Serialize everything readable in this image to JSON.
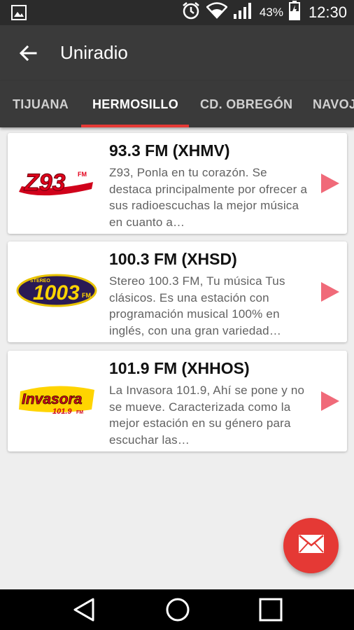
{
  "status_bar": {
    "battery_percent": "43%",
    "time": "12:30",
    "icons": [
      "image-icon",
      "alarm-icon",
      "wifi-icon",
      "signal-icon",
      "battery-charging-icon"
    ]
  },
  "toolbar": {
    "title": "Uniradio",
    "back_icon": "arrow-back-icon"
  },
  "tabs": [
    {
      "label": "TIJUANA",
      "active": false
    },
    {
      "label": "HERMOSILLO",
      "active": true
    },
    {
      "label": "CD. OBREGÓN",
      "active": false
    },
    {
      "label": "NAVOJOA",
      "active": false
    }
  ],
  "stations": [
    {
      "frequency": "93.3 FM (XHMV)",
      "description": "Z93, Ponla en tu corazón. Se destaca principalmente por ofrecer a sus radioescuchas la mejor música en cuanto a…",
      "logo_text": "Z93",
      "logo_suffix": "FM"
    },
    {
      "frequency": "100.3 FM (XHSD)",
      "description": "Stereo 100.3 FM, Tu música Tus clásicos. Es una estación con programación musical 100% en inglés, con una gran variedad…",
      "logo_text": "1003",
      "logo_top": "STEREO",
      "logo_suffix": "FM"
    },
    {
      "frequency": "101.9 FM (XHHOS)",
      "description": "La Invasora 101.9, Ahí se pone y no se mueve. Caracterizada como la mejor estación en su género para escuchar las…",
      "logo_text": "Invasora",
      "logo_sub": "101.9",
      "logo_suffix": "FM"
    }
  ],
  "fab": {
    "icon": "mail-icon"
  },
  "nav_bar": {
    "icons": [
      "nav-back-icon",
      "nav-home-icon",
      "nav-recents-icon"
    ]
  },
  "colors": {
    "accent": "#e53935",
    "toolbar": "#3a3a3a",
    "status_bar": "#2b2b2b",
    "play": "#f06a79"
  }
}
